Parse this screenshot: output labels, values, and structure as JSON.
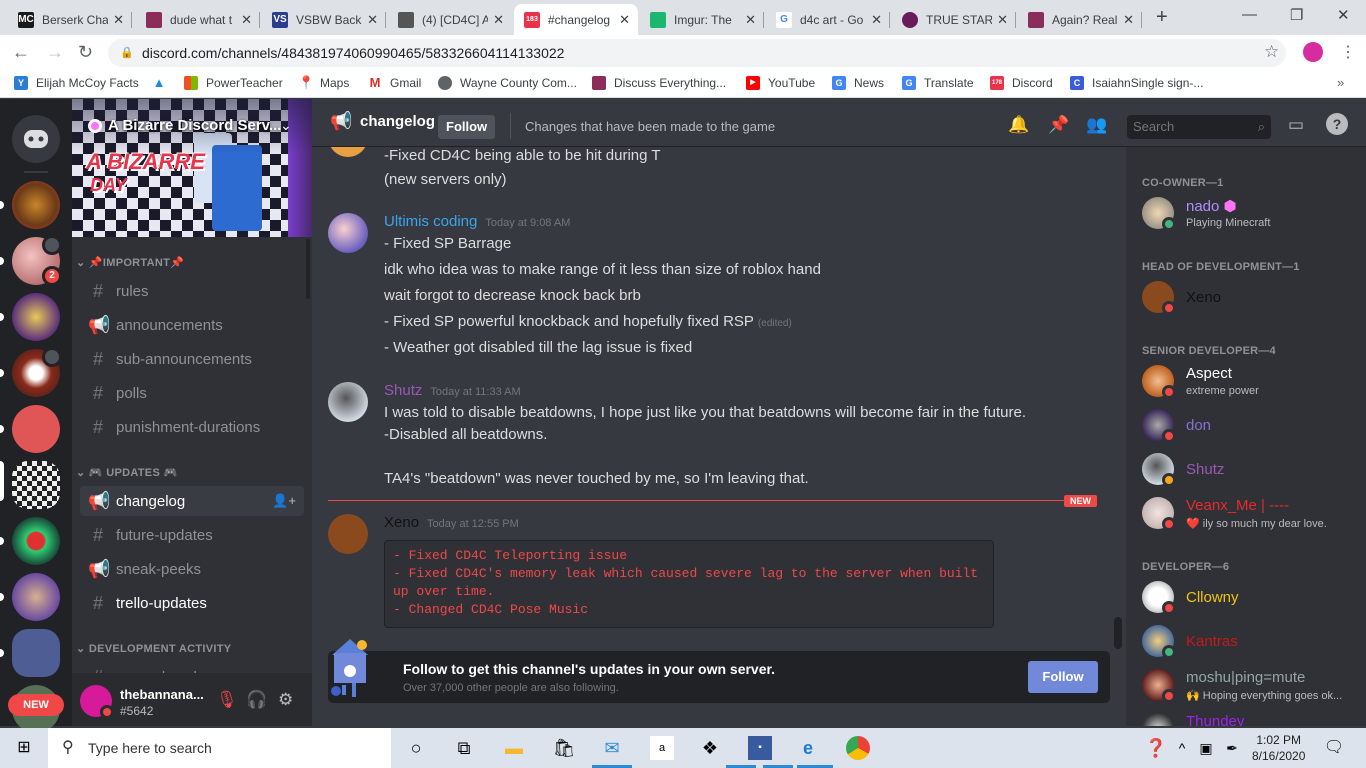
{
  "browser": {
    "tabs": [
      {
        "title": "Berserk Cha",
        "icon": "mc-favicon",
        "icon_color": "#1a1a1a"
      },
      {
        "title": "dude what t",
        "icon": "fox-favicon",
        "icon_color": "#8a2d5a"
      },
      {
        "title": "VSBW Back",
        "icon": "vs-favicon",
        "icon_color": "#2a3d8f"
      },
      {
        "title": "(4) [CD4C] A",
        "icon": "roblox-favicon",
        "icon_color": "#555555"
      },
      {
        "title": "#changelog",
        "icon": "discord-favicon",
        "icon_color": "#e8334b",
        "badge": "183",
        "active": true
      },
      {
        "title": "Imgur: The",
        "icon": "imgur-favicon",
        "icon_color": "#1bb76e"
      },
      {
        "title": "d4c art - Go",
        "icon": "google-favicon",
        "icon_color": "#4285f4"
      },
      {
        "title": "TRUE STAR",
        "icon": "star-favicon",
        "icon_color": "#6a1b5a"
      },
      {
        "title": "Again? Real",
        "icon": "fox-favicon",
        "icon_color": "#8a2d5a"
      }
    ],
    "url": "discord.com/channels/484381974060990465/583326604114133022",
    "bookmarks": [
      {
        "label": "Elijah McCoy Facts",
        "icon": "yd-icon",
        "color": "#2a7fd4"
      },
      {
        "label": "",
        "icon": "triangle-logo-icon",
        "color": "#1e88e5"
      },
      {
        "label": "PowerTeacher",
        "icon": "windows-logo-icon",
        "color": "#f25022"
      },
      {
        "label": "Maps",
        "icon": "maps-pin-icon",
        "color": "#34a853"
      },
      {
        "label": "Gmail",
        "icon": "gmail-icon",
        "color": "#d93025"
      },
      {
        "label": "Wayne County Com...",
        "icon": "globe-icon",
        "color": "#5f6368"
      },
      {
        "label": "Discuss Everything...",
        "icon": "fox-icon",
        "color": "#8a2d5a"
      },
      {
        "label": "YouTube",
        "icon": "youtube-icon",
        "color": "#ff0000"
      },
      {
        "label": "News",
        "icon": "news-icon",
        "color": "#4285f4"
      },
      {
        "label": "Translate",
        "icon": "translate-icon",
        "color": "#4285f4"
      },
      {
        "label": "Discord",
        "icon": "discord-icon",
        "color": "#e8334b",
        "badge": "178"
      },
      {
        "label": "IsaiahnSingle sign-...",
        "icon": "c-icon",
        "color": "#3b5bdb"
      }
    ]
  },
  "discord": {
    "server_name": "A Bizarre Discord Serv...",
    "banner_text": [
      "A BIZARRE",
      "DAY"
    ],
    "guild_badge": "2",
    "guild_new_label": "NEW",
    "categories": {
      "important": "IMPORTANT",
      "updates": "UPDATES",
      "dev_activity": "DEVELOPMENT ACTIVITY"
    },
    "channels_important": [
      {
        "name": "rules",
        "icon": "hash"
      },
      {
        "name": "announcements",
        "icon": "megaphone"
      },
      {
        "name": "sub-announcements",
        "icon": "hash-lock"
      },
      {
        "name": "polls",
        "icon": "hash-lock"
      },
      {
        "name": "punishment-durations",
        "icon": "hash"
      }
    ],
    "channels_updates": [
      {
        "name": "changelog",
        "icon": "megaphone-lock",
        "selected": true
      },
      {
        "name": "future-updates",
        "icon": "hash"
      },
      {
        "name": "sneak-peeks",
        "icon": "megaphone-lock"
      },
      {
        "name": "trello-updates",
        "icon": "hash-lock",
        "unread": true
      }
    ],
    "channels_dev": [
      {
        "name": "gameplay-changes",
        "icon": "hash"
      }
    ],
    "user": {
      "name": "thebannana...",
      "tag": "#5642"
    },
    "header": {
      "channel": "changelog",
      "follow": "Follow",
      "topic": "Changes that have been made to the game",
      "search_placeholder": "Search"
    },
    "messages": [
      {
        "author": "",
        "timestamp": "",
        "lines": [
          "-Fixed CD4C being able to be hit during T",
          "(new servers only)"
        ]
      },
      {
        "author": "Ultimis coding",
        "color": "#3ba5ec",
        "timestamp": "Today at 9:08 AM",
        "lines": [
          "- Fixed SP Barrage",
          "idk who idea was to make range of it less than size of roblox hand",
          "wait forgot to decrease knock back brb",
          "- Fixed SP powerful knockback and hopefully fixed RSP",
          "- Weather got disabled till the lag issue is fixed"
        ],
        "edited_label": "(edited)"
      },
      {
        "author": "Shutz",
        "color": "#9b59b6",
        "timestamp": "Today at 11:33 AM",
        "lines": [
          "I was told to disable beatdowns, I hope just like you that beatdowns will become fair in the future.",
          "-Disabled all beatdowns.",
          "",
          "TA4's \"beatdown\" was never touched by me, so I'm leaving that."
        ]
      },
      {
        "author": "Xeno",
        "color": "#111111",
        "timestamp": "Today at 12:55 PM",
        "code": "- Fixed CD4C Teleporting issue\n- Fixed CD4C's memory leak which caused severe lag to the server when built\nup over time.\n- Changed CD4C Pose Music"
      }
    ],
    "new_divider": "NEW",
    "follow_bar": {
      "title": "Follow to get this channel's updates in your own server.",
      "subtitle": "Over 37,000 other people are also following.",
      "button": "Follow"
    },
    "member_groups": [
      {
        "label": "CO-OWNER—1",
        "members": [
          {
            "name": "nado",
            "color": "#b38cff",
            "status": "online",
            "activity": "Playing Minecraft",
            "boost": true
          }
        ]
      },
      {
        "label": "HEAD OF DEVELOPMENT—1",
        "members": [
          {
            "name": "Xeno",
            "color": "#111111",
            "status": "dnd"
          }
        ]
      },
      {
        "label": "SENIOR DEVELOPER—4",
        "members": [
          {
            "name": "Aspect",
            "color": "#ffffff",
            "status": "dnd",
            "activity": "extreme power"
          },
          {
            "name": "don",
            "color": "#8a6fd0",
            "status": "dnd"
          },
          {
            "name": "Shutz",
            "color": "#9b59b6",
            "status": "idle"
          },
          {
            "name": "Veanx_Me | ----",
            "color": "#e62b2b",
            "status": "dnd",
            "activity": "❤️ ily so much my dear love."
          }
        ]
      },
      {
        "label": "DEVELOPER—6",
        "members": [
          {
            "name": "Cllowny",
            "color": "#f1c40f",
            "status": "dnd"
          },
          {
            "name": "Kantras",
            "color": "#c41a1a",
            "status": "online"
          },
          {
            "name": "moshu|ping=mute",
            "color": "#95a5a6",
            "status": "dnd",
            "activity": "🙌 Hoping everything goes ok..."
          },
          {
            "name": "Thundey",
            "color": "#a020f0",
            "status": "dnd"
          }
        ]
      }
    ]
  },
  "taskbar": {
    "search_placeholder": "Type here to search",
    "time": "1:02 PM",
    "date": "8/16/2020"
  }
}
